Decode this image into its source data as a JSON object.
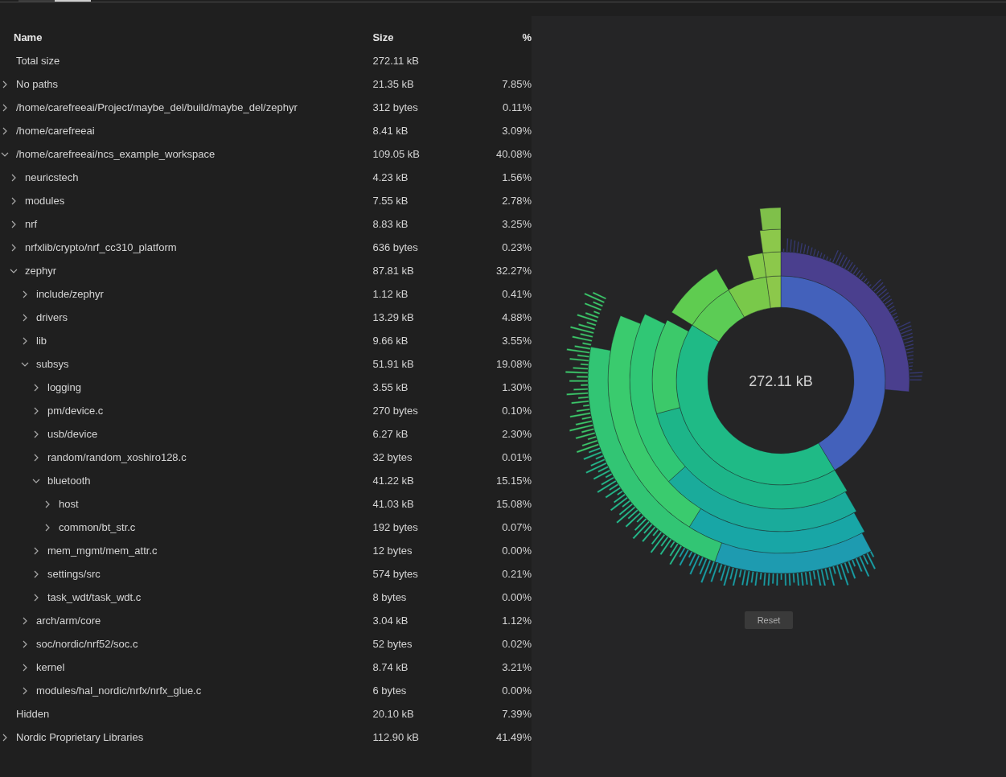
{
  "tabs": [
    {
      "selected": false
    },
    {
      "selected": true
    }
  ],
  "table": {
    "columns": [
      "Name",
      "Size",
      "%"
    ],
    "rows": [
      {
        "kind": "summary",
        "name": "Total size",
        "size": "272.11 kB"
      },
      {
        "kind": "folder",
        "name": "No paths",
        "size": "21.35 kB",
        "percent": "7.85%",
        "expanded": false
      },
      {
        "kind": "folder",
        "name": "/home/carefreeai/Project/maybe_del/build/maybe_del/zephyr",
        "size": "312 bytes",
        "percent": "0.11%",
        "expanded": false
      },
      {
        "kind": "folder",
        "name": "/home/carefreeai",
        "size": "8.41 kB",
        "percent": "3.09%",
        "expanded": false
      },
      {
        "kind": "folder",
        "name": "/home/carefreeai/ncs_example_workspace",
        "size": "109.05 kB",
        "percent": "40.08%",
        "expanded": true,
        "children": [
          {
            "kind": "folder",
            "name": "neuricstech",
            "size": "4.23 kB",
            "percent": "1.56%",
            "expanded": false
          },
          {
            "kind": "folder",
            "name": "modules",
            "size": "7.55 kB",
            "percent": "2.78%",
            "expanded": false
          },
          {
            "kind": "folder",
            "name": "nrf",
            "size": "8.83 kB",
            "percent": "3.25%",
            "expanded": false
          },
          {
            "kind": "folder",
            "name": "nrfxlib/crypto/nrf_cc310_platform",
            "size": "636 bytes",
            "percent": "0.23%",
            "expanded": false
          },
          {
            "kind": "folder",
            "name": "zephyr",
            "size": "87.81 kB",
            "percent": "32.27%",
            "expanded": true,
            "children": [
              {
                "kind": "folder",
                "name": "include/zephyr",
                "size": "1.12 kB",
                "percent": "0.41%",
                "expanded": false
              },
              {
                "kind": "folder",
                "name": "drivers",
                "size": "13.29 kB",
                "percent": "4.88%",
                "expanded": false
              },
              {
                "kind": "folder",
                "name": "lib",
                "size": "9.66 kB",
                "percent": "3.55%",
                "expanded": false
              },
              {
                "kind": "folder",
                "name": "subsys",
                "size": "51.91 kB",
                "percent": "19.08%",
                "expanded": true,
                "children": [
                  {
                    "kind": "folder",
                    "name": "logging",
                    "size": "3.55 kB",
                    "percent": "1.30%",
                    "expanded": false
                  },
                  {
                    "kind": "folder",
                    "name": "pm/device.c",
                    "size": "270 bytes",
                    "percent": "0.10%",
                    "expanded": false
                  },
                  {
                    "kind": "folder",
                    "name": "usb/device",
                    "size": "6.27 kB",
                    "percent": "2.30%",
                    "expanded": false
                  },
                  {
                    "kind": "folder",
                    "name": "random/random_xoshiro128.c",
                    "size": "32 bytes",
                    "percent": "0.01%",
                    "expanded": false
                  },
                  {
                    "kind": "folder",
                    "name": "bluetooth",
                    "size": "41.22 kB",
                    "percent": "15.15%",
                    "expanded": true,
                    "children": [
                      {
                        "kind": "folder",
                        "name": "host",
                        "size": "41.03 kB",
                        "percent": "15.08%",
                        "expanded": false
                      },
                      {
                        "kind": "folder",
                        "name": "common/bt_str.c",
                        "size": "192 bytes",
                        "percent": "0.07%",
                        "expanded": false
                      }
                    ]
                  },
                  {
                    "kind": "folder",
                    "name": "mem_mgmt/mem_attr.c",
                    "size": "12 bytes",
                    "percent": "0.00%",
                    "expanded": false
                  },
                  {
                    "kind": "folder",
                    "name": "settings/src",
                    "size": "574 bytes",
                    "percent": "0.21%",
                    "expanded": false
                  },
                  {
                    "kind": "folder",
                    "name": "task_wdt/task_wdt.c",
                    "size": "8 bytes",
                    "percent": "0.00%",
                    "expanded": false
                  }
                ]
              },
              {
                "kind": "folder",
                "name": "arch/arm/core",
                "size": "3.04 kB",
                "percent": "1.12%",
                "expanded": false
              },
              {
                "kind": "folder",
                "name": "soc/nordic/nrf52/soc.c",
                "size": "52 bytes",
                "percent": "0.02%",
                "expanded": false
              },
              {
                "kind": "folder",
                "name": "kernel",
                "size": "8.74 kB",
                "percent": "3.21%",
                "expanded": false
              },
              {
                "kind": "folder",
                "name": "modules/hal_nordic/nrfx/nrfx_glue.c",
                "size": "6 bytes",
                "percent": "0.00%",
                "expanded": false
              }
            ]
          }
        ]
      },
      {
        "kind": "summary",
        "name": "Hidden",
        "size": "20.10 kB",
        "percent": "7.39%"
      },
      {
        "kind": "folder",
        "name": "Nordic Proprietary Libraries",
        "size": "112.90 kB",
        "percent": "41.49%",
        "expanded": false
      }
    ]
  },
  "sunburst": {
    "center_label": "272.11 kB"
  },
  "reset_button": "Reset"
}
